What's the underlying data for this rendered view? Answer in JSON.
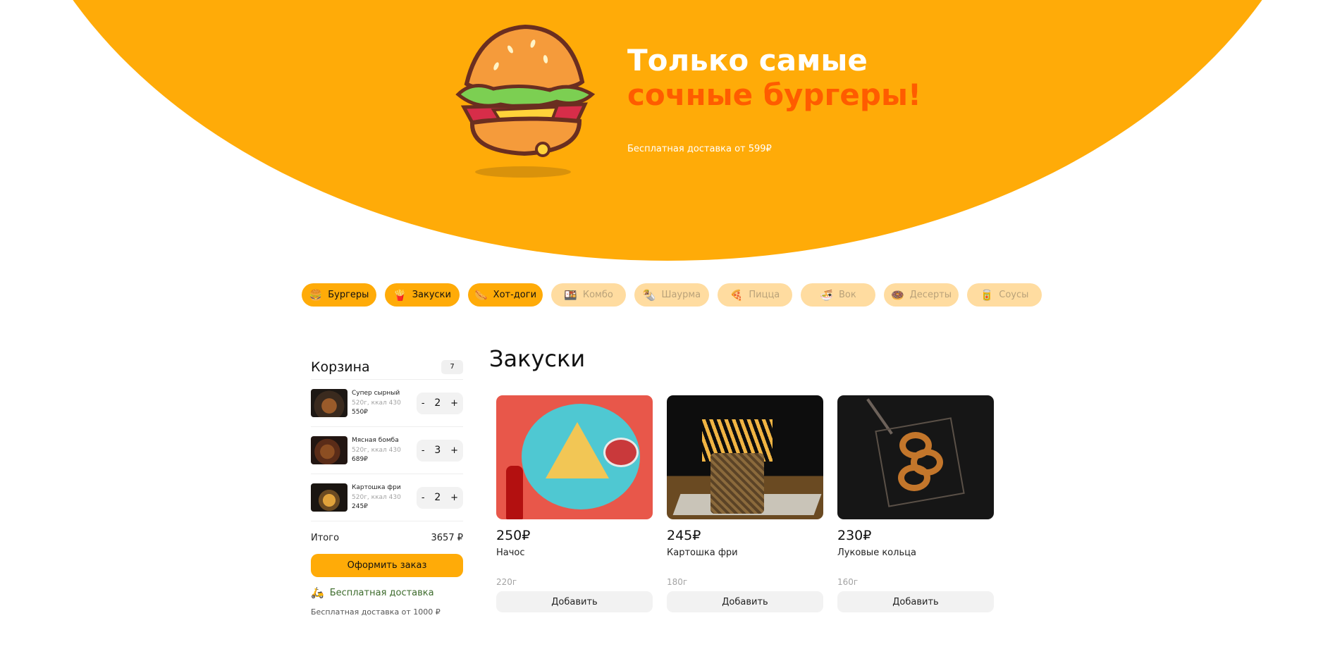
{
  "hero": {
    "title_line1": "Только самые",
    "title_line2": "сочные бургеры!",
    "subtitle": "Бесплатная доставка от 599₽",
    "image_icon": "burger-illustration",
    "accent_color": "#ffab08",
    "title_accent_color": "#ff5c00"
  },
  "categories": [
    {
      "label": "Бургеры",
      "icon": "🍔",
      "active": true
    },
    {
      "label": "Закуски",
      "icon": "🍟",
      "active": true
    },
    {
      "label": "Хот-доги",
      "icon": "🌭",
      "active": true
    },
    {
      "label": "Комбо",
      "icon": "🍱",
      "active": false
    },
    {
      "label": "Шаурма",
      "icon": "🌯",
      "active": false
    },
    {
      "label": "Пицца",
      "icon": "🍕",
      "active": false
    },
    {
      "label": "Вок",
      "icon": "🍜",
      "active": false
    },
    {
      "label": "Десерты",
      "icon": "🍩",
      "active": false
    },
    {
      "label": "Соусы",
      "icon": "🥫",
      "active": false
    }
  ],
  "cart": {
    "title": "Корзина",
    "count": "7",
    "items": [
      {
        "name": "Супер сырный",
        "meta": "520г, ккал 430",
        "price": "550₽",
        "qty": "2"
      },
      {
        "name": "Мясная бомба",
        "meta": "520г, ккал 430",
        "price": "689₽",
        "qty": "3"
      },
      {
        "name": "Картошка фри",
        "meta": "520г, ккал 430",
        "price": "245₽",
        "qty": "2"
      }
    ],
    "minus": "-",
    "plus": "+",
    "total_label": "Итого",
    "total_value": "3657 ₽",
    "order_button": "Оформить заказ",
    "free_delivery_label": "Бесплатная доставка",
    "free_delivery_note": "Бесплатная доставка от 1000 ₽"
  },
  "section": {
    "title": "Закуски"
  },
  "products": [
    {
      "price": "250₽",
      "name": "Начос",
      "weight": "220г",
      "button": "Добавить"
    },
    {
      "price": "245₽",
      "name": "Картошка фри",
      "weight": "180г",
      "button": "Добавить"
    },
    {
      "price": "230₽",
      "name": "Луковые кольца",
      "weight": "160г",
      "button": "Добавить"
    }
  ]
}
